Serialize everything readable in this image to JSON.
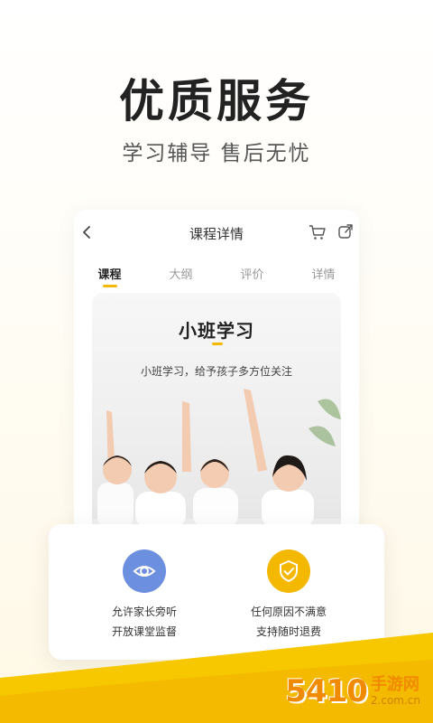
{
  "hero": {
    "title": "优质服务",
    "subtitle": "学习辅导 售后无忧"
  },
  "phone": {
    "nav": {
      "title": "课程详情",
      "icons": [
        "back-icon",
        "cart-icon",
        "share-icon"
      ]
    },
    "tabs": [
      {
        "label": "课程",
        "active": true
      },
      {
        "label": "大纲",
        "active": false
      },
      {
        "label": "评价",
        "active": false
      },
      {
        "label": "详情",
        "active": false
      }
    ],
    "content": {
      "title": "小班学习",
      "description": "小班学习，给予孩子多方位关注"
    }
  },
  "features": [
    {
      "icon": "eye-icon",
      "color": "#6d8fe0",
      "line1": "允许家长旁听",
      "line2": "开放课堂监督"
    },
    {
      "icon": "shield-check-icon",
      "color": "#f5b800",
      "line1": "任何原因不满意",
      "line2": "支持随时退费"
    }
  ],
  "watermark": {
    "number": "5410",
    "name": "手游网",
    "domain": "2.com.cn"
  },
  "colors": {
    "accent": "#f5b800",
    "feature_blue": "#6d8fe0"
  }
}
